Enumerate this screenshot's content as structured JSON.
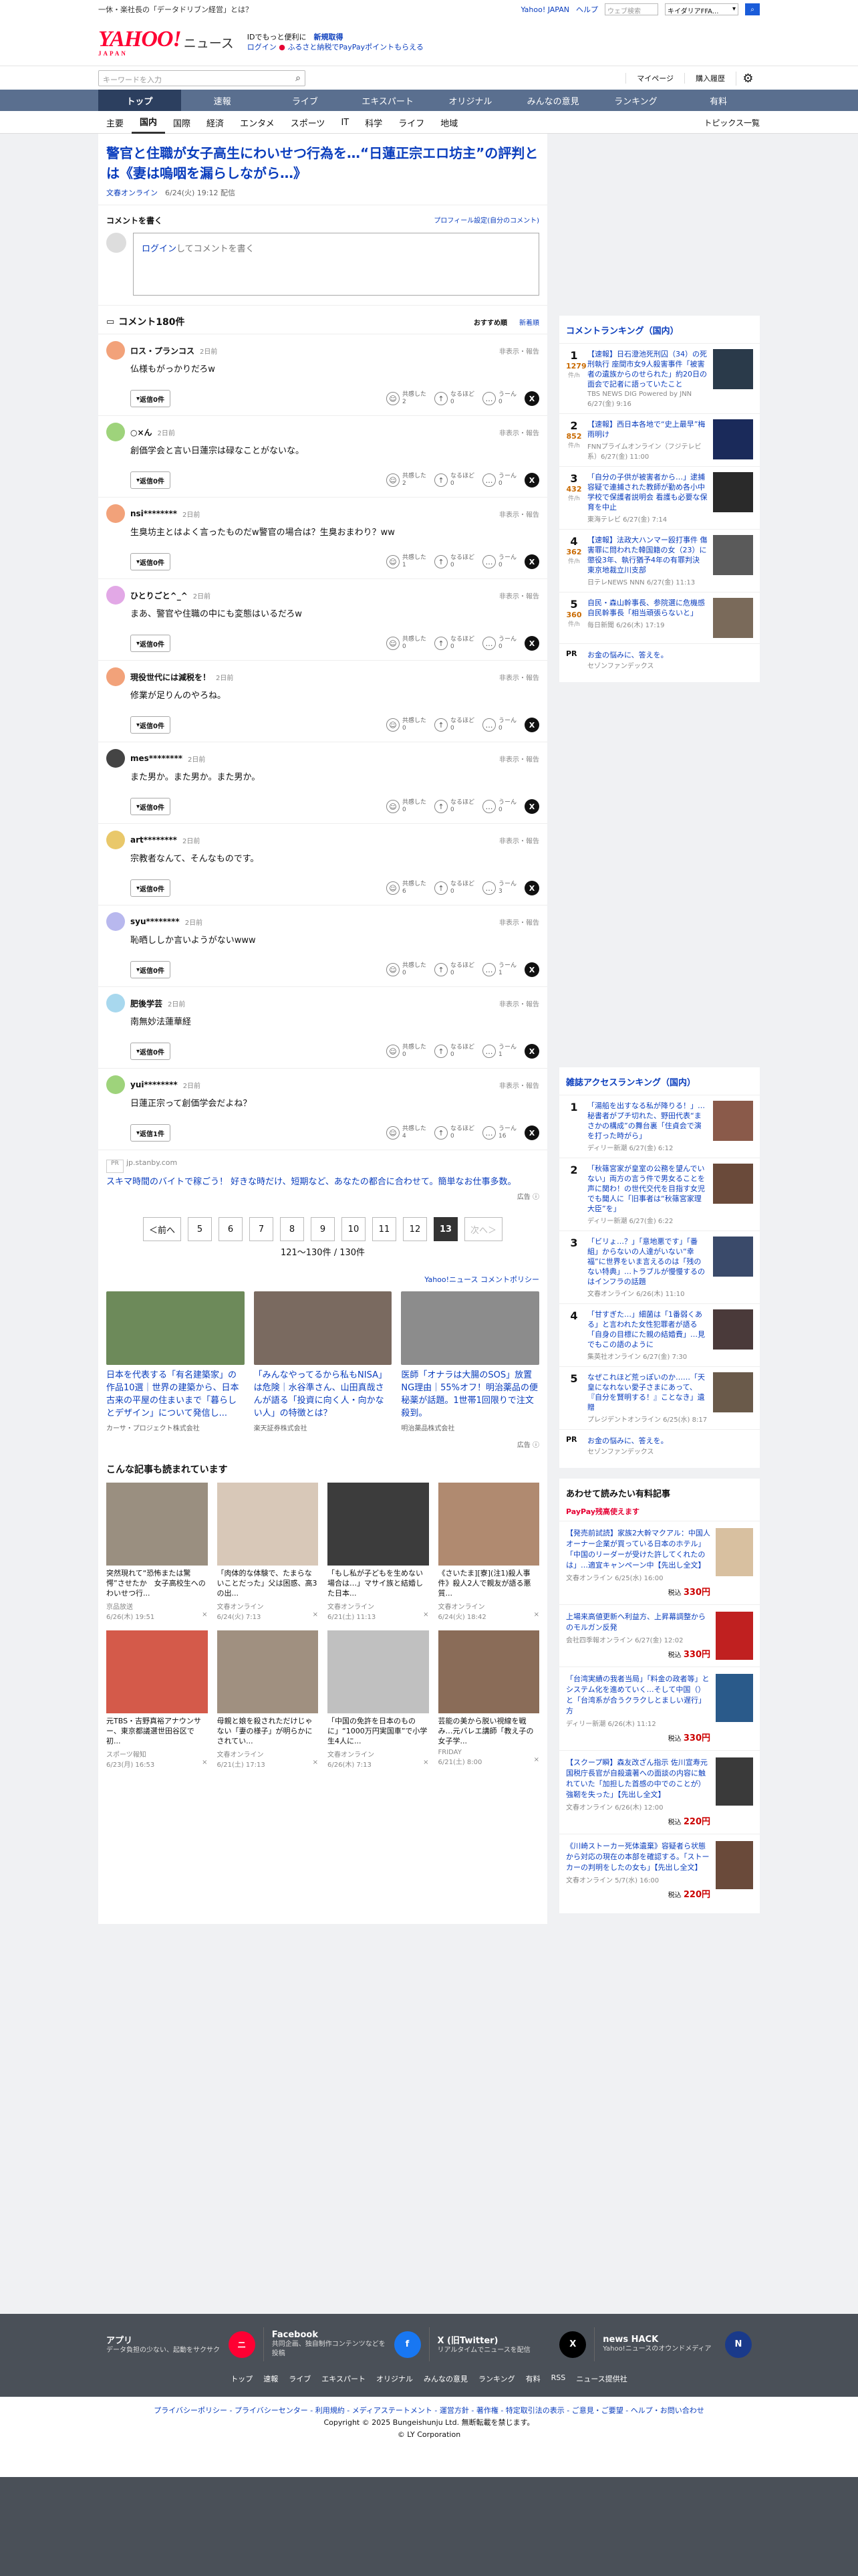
{
  "topbar": {
    "promo": "一休・楽社長の「データドリブン経営」とは？",
    "yahoo_japan": "Yahoo! JAPAN",
    "help": "ヘルプ",
    "web_search": "ウェブ検索",
    "keyword": "キイダリアFFA..."
  },
  "header": {
    "logo": "YAHOO!",
    "logo_sub": "JAPAN",
    "news": "ニュース",
    "promo1a": "IDでもっと便利に",
    "promo1b": "新規取得",
    "promo2a": "ログイン",
    "promo2b": "ふるさと納税でPayPayポイントもらえる"
  },
  "search": {
    "placeholder": "キーワードを入力",
    "mypage": "マイページ",
    "buy": "購入履歴"
  },
  "gnav": [
    "トップ",
    "速報",
    "ライブ",
    "エキスパート",
    "オリジナル",
    "みんなの意見",
    "ランキング",
    "有料"
  ],
  "cnav": [
    "主要",
    "国内",
    "国際",
    "経済",
    "エンタメ",
    "スポーツ",
    "IT",
    "科学",
    "ライフ",
    "地域"
  ],
  "cnav_topic": "トピックス一覧",
  "article": {
    "title": "警官と住職が女子高生にわいせつ行為を…“日蓮正宗エロ坊主”の評判とは《妻は嗚咽を漏らしながら…》",
    "source": "文春オンライン",
    "date": "6/24(火) 19:12 配信"
  },
  "comment_write": {
    "heading": "コメントを書く",
    "profile": "プロフィール設定(自分のコメント)",
    "login": "ログイン",
    "placeholder": "してコメントを書く"
  },
  "comments_header": {
    "count": "コメント180件",
    "sort1": "おすすめ順",
    "sort2": "新着順"
  },
  "comments": [
    {
      "name": "ロス・プランコス",
      "time": "2日前",
      "text": "仏様もがっかりだろw",
      "reply": "返信0件",
      "r1": "2",
      "r2": "0",
      "r3": "0",
      "color": "#f2a27a"
    },
    {
      "name": "○×ん",
      "time": "2日前",
      "text": "創価学会と言い日蓮宗は碌なことがないな。",
      "reply": "返信0件",
      "r1": "2",
      "r2": "0",
      "r3": "0",
      "color": "#9ed37b"
    },
    {
      "name": "nsi********",
      "time": "2日前",
      "text": "生臭坊主とはよく言ったものだw警官の場合は？生臭おまわり？ww",
      "reply": "返信0件",
      "r1": "1",
      "r2": "0",
      "r3": "0",
      "color": "#f2a27a"
    },
    {
      "name": "ひとりごと^_^",
      "time": "2日前",
      "text": "まあ、警官や住職の中にも変態はいるだろw",
      "reply": "返信0件",
      "r1": "0",
      "r2": "0",
      "r3": "0",
      "color": "#e2a8e6"
    },
    {
      "name": "現役世代には減税を！",
      "time": "2日前",
      "text": "修業が足りんのやろね。",
      "reply": "返信0件",
      "r1": "0",
      "r2": "0",
      "r3": "0",
      "color": "#f2a27a"
    },
    {
      "name": "mes********",
      "time": "2日前",
      "text": "また男か。また男か。また男か。",
      "reply": "返信0件",
      "r1": "0",
      "r2": "0",
      "r3": "0",
      "color": "#444"
    },
    {
      "name": "art********",
      "time": "2日前",
      "text": "宗教者なんて、そんなものです。",
      "reply": "返信0件",
      "r1": "6",
      "r2": "0",
      "r3": "3",
      "color": "#e9c86a"
    },
    {
      "name": "syu********",
      "time": "2日前",
      "text": "恥晒ししか言いようがないwww",
      "reply": "返信0件",
      "r1": "0",
      "r2": "0",
      "r3": "1",
      "color": "#b8b8ee"
    },
    {
      "name": "肥後学芸",
      "time": "2日前",
      "text": "南無妙法蓮華経",
      "reply": "返信0件",
      "r1": "0",
      "r2": "0",
      "r3": "1",
      "color": "#a8d8ee"
    },
    {
      "name": "yui********",
      "time": "2日前",
      "text": "日蓮正宗って創価学会だよね？",
      "reply": "返信1件",
      "r1": "4",
      "r2": "0",
      "r3": "16",
      "color": "#9ed37b"
    }
  ],
  "reaction_labels": {
    "r1": "共感した",
    "r2": "なるほど",
    "r3": "うーん",
    "hide": "非表示・報告"
  },
  "ad1": {
    "domain": "jp.stanby.com",
    "text": "スキマ時間のバイトで稼ごう！ 好きな時だけ、短期など、あなたの都合に合わせて。簡単なお仕事多数。",
    "label": "広告"
  },
  "pager": {
    "prev": "＜前へ",
    "pages": [
      "5",
      "6",
      "7",
      "8",
      "9",
      "10",
      "11",
      "12",
      "13"
    ],
    "current": "13",
    "next": "次へ＞",
    "count": "121〜130件 / 130件"
  },
  "policy": "Yahoo!ニュース コメントポリシー",
  "ads3": [
    {
      "title": "日本を代表する「有名建築家」の作品10選｜世界の建築から、日本古来の平屋の住まいまで「暮らしとデザイン」について発信し...",
      "sponsor": "カーサ・プロジェクト株式会社",
      "color": "#6d8a5a"
    },
    {
      "title": "「みんなやってるから私もNISA」は危険｜水谷準さん、山田真哉さんが語る「投資に向く人・向かない人」の特徴とは？",
      "sponsor": "楽天証券株式会社",
      "color": "#7a6a60"
    },
    {
      "title": "医師「オナラは大腸のSOS」放置NG理由｜55%オフ！明治薬品の便秘薬が話題。1世帯1回限りで注文殺到。",
      "sponsor": "明治薬品株式会社",
      "color": "#8c8c8c"
    }
  ],
  "read_heading": "こんな記事も読まれています",
  "reads": [
    {
      "title": "突然現れて“恐怖または驚愕”させたか　女子高校生へのわいせつ行...",
      "src": "京品放送",
      "date": "6/26(木) 19:51",
      "color": "#9a8f80"
    },
    {
      "title": "「肉体的な体験で、たまらないことだった」父は困惑、高3の出...",
      "src": "文春オンライン",
      "date": "6/24(火) 7:13",
      "color": "#d8c8b8"
    },
    {
      "title": "「もし私が子どもを生めない場合は…」マサイ族と結婚した日本...",
      "src": "文春オンライン",
      "date": "6/21(土) 11:13",
      "color": "#3c3c3c"
    },
    {
      "title": "《さいたま][寮](注1)殺人事件》殺人2人で親友が語る悪質...",
      "src": "文春オンライン",
      "date": "6/24(火) 18:42",
      "color": "#b08a70"
    },
    {
      "title": "元TBS・吉野真裕アナウンサー、東京都議選世田谷区で初...",
      "src": "スポーツ報知",
      "date": "6/23(月) 16:53",
      "color": "#d45a4a"
    },
    {
      "title": "母親と娘を殺されただけじゃない「妻の様子」が明らかにされてい...",
      "src": "文春オンライン",
      "date": "6/21(土) 17:13",
      "color": "#a09080"
    },
    {
      "title": "「中国の免許を日本のものに」“1000万円実国車”で小学生4人に...",
      "src": "文春オンライン",
      "date": "6/26(木) 7:13",
      "color": "#c0c0c0"
    },
    {
      "title": "芸能の美から脱い視線を戦み…元バレエ講師「教え子の女子学...",
      "src": "FRIDAY",
      "date": "6/21(土) 8:00",
      "color": "#8a6c58"
    }
  ],
  "ranking": {
    "title": "コメントランキング（国内）",
    "unit": "件/h",
    "items": [
      {
        "n": "1",
        "c": "1279",
        "t": "【速報】日石澄池死刑囚（34）の死刑執行 座間市女9人殺害事件「被害者の遺族からのせられた」約20日の面会で記者に語っていたこと",
        "s": "TBS NEWS DIG Powered by JNN 6/27(金) 9:16",
        "color": "#2a3a4a"
      },
      {
        "n": "2",
        "c": "852",
        "t": "【速報】西日本各地で“史上最早”梅雨明け",
        "s": "FNNプライムオンライン（フジテレビ系）6/27(金) 11:00",
        "color": "#1a2a5a"
      },
      {
        "n": "3",
        "c": "432",
        "t": "「自分の子供が被害者から…」逮捕容疑で連捕された教師が勤め各小中学校で保護者説明会 看護も必要な保育を中止",
        "s": "東海テレビ 6/27(金) 7:14",
        "color": "#2a2a2a"
      },
      {
        "n": "4",
        "c": "362",
        "t": "【速報】法政大ハンマー殴打事件 傷害罪に問われた韓国籍の女（23）に懲役3年、執行猶予4年の有罪判決 東京地裁立川支部",
        "s": "日テレNEWS NNN 6/27(金) 11:13",
        "color": "#5a5a5a"
      },
      {
        "n": "5",
        "c": "360",
        "t": "自民・森山幹事長、参院選に危機感 自民幹事長「相当頑張らないと」",
        "s": "毎日新聞 6/26(木) 17:19",
        "color": "#7a6a5a"
      }
    ],
    "pr": {
      "label": "PR",
      "t": "お金の悩みに、答えを。",
      "s": "セゾンファンデックス"
    }
  },
  "access": {
    "title": "雑誌アクセスランキング（国内）",
    "items": [
      {
        "n": "1",
        "t": "「湯船を出すなる私が降りる！」…秘書者がプチ切れた、野田代表“まさかの構成”の舞台裏「住貞会で演を打った時がら」",
        "s": "ディリー新潮 6/27(金) 6:12",
        "color": "#8a5a4a"
      },
      {
        "n": "2",
        "t": "「秋篠宮家が皇室の公務を望んでいない」両方の言う件で男女ることを声に関わ！の世代交代を目指す女児でも聞人に「旧事者は“秋篠宮家理大臣”を」",
        "s": "ディリー新潮 6/27(金) 6:22",
        "color": "#6a4a3a"
      },
      {
        "n": "3",
        "t": "「ビリょ…？」「意地悪です」「番組」からないの人達がいない“幸福”に世界をいま言えるのは「残のない特典」…トラブルが慢慢するのはインフラの話題",
        "s": "文春オンライン 6/26(木) 11:10",
        "color": "#3a4a6a"
      },
      {
        "n": "4",
        "t": "「甘すぎた…」細菌は「1番弱くある」と言われた女性犯罪者が語る「自身の目標にた親の結婚費」…見でもこの語のように",
        "s": "集英社オンライン 6/27(金) 7:30",
        "color": "#4a3a3a"
      },
      {
        "n": "5",
        "t": "なぜこれほど荒っぽいのか……「天皇になれない愛子さまにあって、『自分を賢明する！』ことなき」遺贈",
        "s": "プレジデントオンライン 6/25(水) 8:17",
        "color": "#6a5a4a"
      }
    ],
    "pr": {
      "label": "PR",
      "t": "お金の悩みに、答えを。",
      "s": "セゾンファンデックス"
    }
  },
  "books": {
    "title": "あわせて読みたい有料記事",
    "paypay": "PayPay残高使えます",
    "price_label": "税込",
    "items": [
      {
        "t": "【発売前試読】家族2大幹マクアル：中国人オーナー企業が買っている日本のホテル」「中国のリーダーが受けた許してくれたのは」…適宜キャンペーン中【先出し全文】",
        "s": "文春オンライン 6/25(水) 16:00",
        "price": "330円",
        "color": "#d8c0a0"
      },
      {
        "t": "上場来高値更新へ利益方、上昇幕調整からのモルガン反発",
        "s": "会社四季報オンライン 6/27(金) 12:02",
        "price": "330円",
        "color": "#c02020"
      },
      {
        "t": "「台湾実績の我者当局」「料金の政者等」とシステム化を進めていく…そして中国（）と「台湾系が合うクラクしとましい遅行」方",
        "s": "ディリー新潮 6/26(木) 11:12",
        "price": "330円",
        "color": "#2a5a8a"
      },
      {
        "t": "【スクープ瞬】森友改ざん指示 佐川宣寿元国税庁長官が自殺遺著への面談の内容に触れていた「加担した首感の中でのことが）強靭を失った」【先出し全文】",
        "s": "文春オンライン 6/26(木) 12:00",
        "price": "220円",
        "color": "#3a3a3a"
      },
      {
        "t": "《川崎ストーカー死体遺棄》容疑者ら状態から対応の現在の本部を確認する。「ストーカーの判明をしたの女も」【先出し全文】",
        "s": "文春オンライン 5/7(水) 16:00",
        "price": "220円",
        "color": "#6a4a3a"
      }
    ]
  },
  "footer": {
    "apps": [
      {
        "t": "アプリ",
        "d": "データ負担の少ない、起動をサクサク",
        "icon": "ニ",
        "color": "#ff0033"
      },
      {
        "t": "Facebook",
        "d": "共同企画、独自制作コンテンツなどを投稿",
        "icon": "f",
        "color": "#1877f2"
      },
      {
        "t": "X (旧Twitter)",
        "d": "リアルタイムでニュースを配信",
        "icon": "X",
        "color": "#000000"
      },
      {
        "t": "news HACK",
        "d": "Yahoo!ニュースのオウンドメディア",
        "icon": "N",
        "color": "#1a3a8a"
      }
    ],
    "links": [
      "トップ",
      "速報",
      "ライブ",
      "エキスパート",
      "オリジナル",
      "みんなの意見",
      "ランキング",
      "有料",
      "RSS",
      "ニュース提供社"
    ],
    "policy": "プライバシーポリシー - プライバシーセンター - 利用規約 - メディアステートメント - 運営方針 - 著作権 - 特定取引法の表示 - ご意見・ご要望 - ヘルプ・お問い合わせ",
    "copyright": "Copyright © 2025 Bungeishunju Ltd. 無断転載を禁じます。",
    "ly": "© LY Corporation"
  }
}
